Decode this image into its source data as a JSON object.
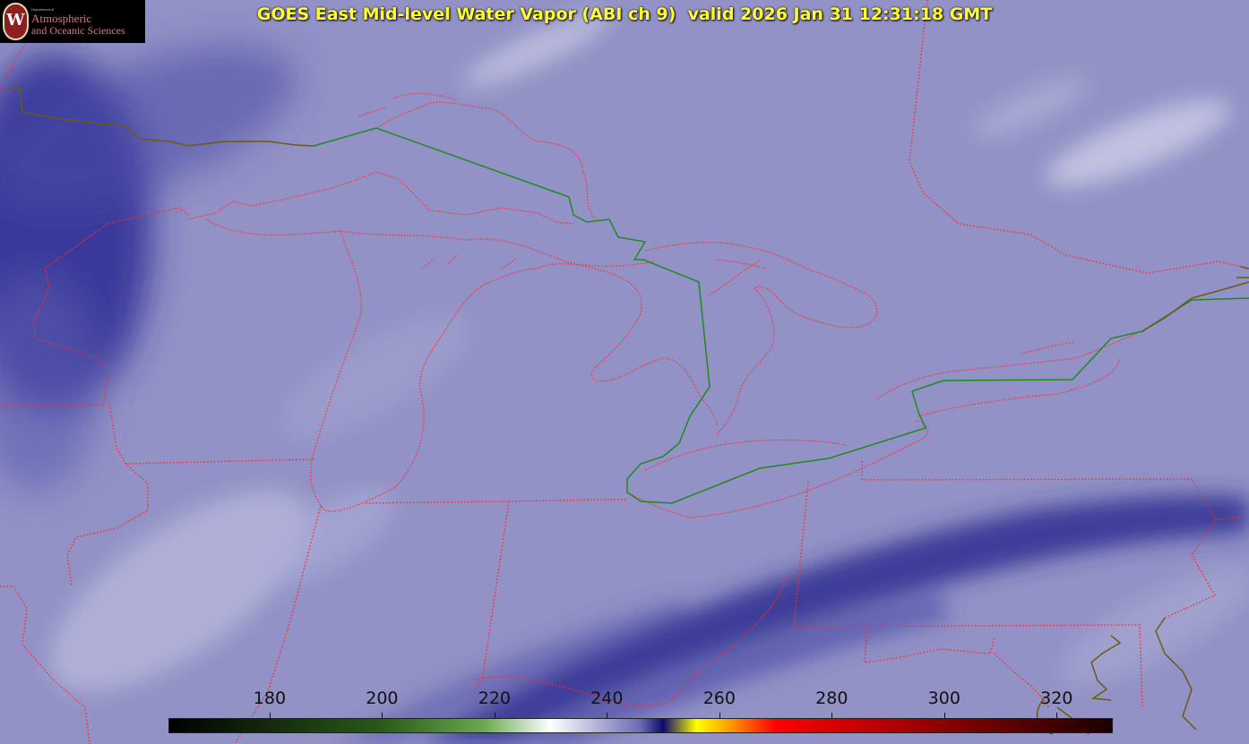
{
  "title": "GOES East Mid-level Water Vapor (ABI ch 9)  valid 2026 Jan 31 12:31:18 GMT",
  "logo": {
    "dept": "Department of",
    "line1": "Atmospheric",
    "line2": "and Oceanic Sciences",
    "seal_letter": "W"
  },
  "colorbar": {
    "min": 162,
    "max": 330,
    "ticks": [
      "180",
      "200",
      "220",
      "240",
      "260",
      "280",
      "300",
      "320"
    ],
    "tick_values": [
      180,
      200,
      220,
      240,
      260,
      280,
      300,
      320
    ],
    "stops": [
      {
        "v": 162,
        "c": "#000000"
      },
      {
        "v": 200,
        "c": "#2a5a1a"
      },
      {
        "v": 218,
        "c": "#6aa84f"
      },
      {
        "v": 230,
        "c": "#ffffff"
      },
      {
        "v": 246,
        "c": "#6b6bb4"
      },
      {
        "v": 250,
        "c": "#0a0a6e"
      },
      {
        "v": 256,
        "c": "#ffff00"
      },
      {
        "v": 262,
        "c": "#ff9900"
      },
      {
        "v": 270,
        "c": "#ff0000"
      },
      {
        "v": 300,
        "c": "#8b0000"
      },
      {
        "v": 330,
        "c": "#1a0000"
      }
    ]
  },
  "colors": {
    "background": "#8f8fc4",
    "borders": "#ff2a2a",
    "international_border": "#1f8a1f",
    "coastline": "#5a5a10",
    "title": "#ffff33"
  }
}
